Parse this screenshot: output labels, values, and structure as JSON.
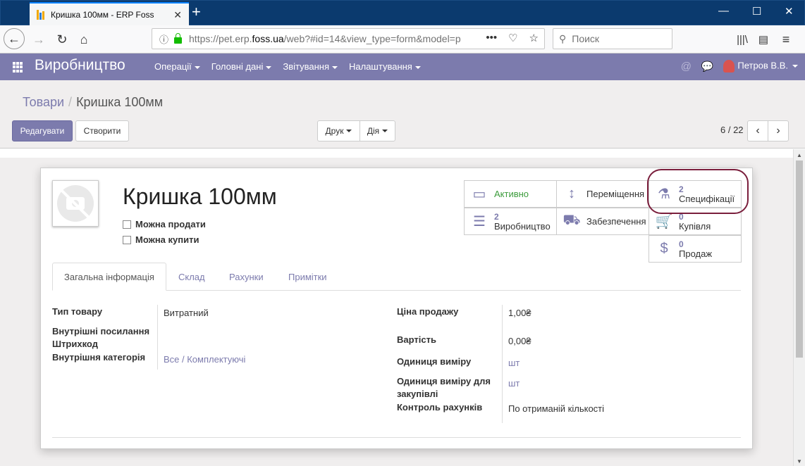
{
  "browser": {
    "tab_title": "Кришка 100мм - ERP Foss",
    "url_prefix": "https://pet.erp.",
    "url_domain": "foss.ua",
    "url_suffix": "/web?#id=14&view_type=form&model=p",
    "search_placeholder": "Поиск"
  },
  "app": {
    "title": "Виробництво",
    "menu": [
      "Операції",
      "Головні дані",
      "Звітування",
      "Налаштування"
    ],
    "user": "Петров В.В."
  },
  "breadcrumb": {
    "parent": "Товари",
    "current": "Кришка 100мм"
  },
  "toolbar": {
    "edit": "Редагувати",
    "create": "Створити",
    "print": "Друк",
    "action": "Дія",
    "pager": "6 / 22"
  },
  "product": {
    "name": "Кришка 100мм",
    "can_be_sold": "Можна продати",
    "can_be_purchased": "Можна купити"
  },
  "stats": {
    "active": "Активно",
    "moves": "Переміщення",
    "bom_count": "2",
    "bom_label": "Специфікації",
    "mo_count": "2",
    "mo_label": "Виробництво",
    "supply": "Забезпечення",
    "purchase_count": "0",
    "purchase_label": "Купівля",
    "sale_count": "0",
    "sale_label": "Продаж"
  },
  "tabs": [
    "Загальна інформація",
    "Склад",
    "Рахунки",
    "Примітки"
  ],
  "fields_left": {
    "type_label": "Тип товару",
    "type_value": "Витратний",
    "ref_label": "Внутрішні посилання",
    "barcode_label": "Штрихкод",
    "category_label": "Внутрішня категорія",
    "category_value": "Все / Комплектуючі"
  },
  "fields_right": {
    "price_label": "Ціна продажу",
    "price_value": "1,00₴",
    "cost_label": "Вартість",
    "cost_value": "0,00₴",
    "uom_label": "Одиниця виміру",
    "uom_value": "шт",
    "uom_po_label": "Одиниця виміру для закупівлі",
    "uom_po_value": "шт",
    "invoice_label": "Контроль рахунків",
    "invoice_value": "По отриманій кількості"
  },
  "colors": {
    "brand": "#7c7bad",
    "highlight": "#7a1e3c"
  }
}
